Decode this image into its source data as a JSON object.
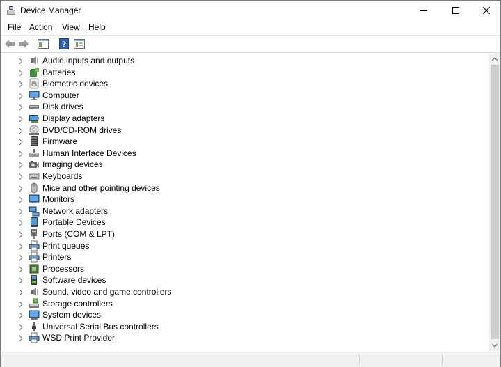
{
  "window": {
    "title": "Device Manager"
  },
  "menu": [
    {
      "label": "File",
      "key": "F",
      "rest": "ile"
    },
    {
      "label": "Action",
      "key": "A",
      "rest": "ction"
    },
    {
      "label": "View",
      "key": "V",
      "rest": "iew"
    },
    {
      "label": "Help",
      "key": "H",
      "rest": "elp"
    }
  ],
  "toolbar": {
    "buttons": [
      "back-arrow-icon",
      "forward-arrow-icon",
      "show-hide-console-tree-icon",
      "help-icon",
      "properties-icon"
    ]
  },
  "tree": {
    "items": [
      {
        "label": "Audio inputs and outputs",
        "icon": "speaker-icon"
      },
      {
        "label": "Batteries",
        "icon": "battery-icon"
      },
      {
        "label": "Biometric devices",
        "icon": "fingerprint-icon"
      },
      {
        "label": "Computer",
        "icon": "computer-icon"
      },
      {
        "label": "Disk drives",
        "icon": "disk-drive-icon"
      },
      {
        "label": "Display adapters",
        "icon": "display-adapter-icon"
      },
      {
        "label": "DVD/CD-ROM drives",
        "icon": "dvd-drive-icon"
      },
      {
        "label": "Firmware",
        "icon": "firmware-icon"
      },
      {
        "label": "Human Interface Devices",
        "icon": "hid-icon"
      },
      {
        "label": "Imaging devices",
        "icon": "camera-icon"
      },
      {
        "label": "Keyboards",
        "icon": "keyboard-icon"
      },
      {
        "label": "Mice and other pointing devices",
        "icon": "mouse-icon"
      },
      {
        "label": "Monitors",
        "icon": "monitor-icon"
      },
      {
        "label": "Network adapters",
        "icon": "network-adapter-icon"
      },
      {
        "label": "Portable Devices",
        "icon": "portable-device-icon"
      },
      {
        "label": "Ports (COM & LPT)",
        "icon": "port-icon"
      },
      {
        "label": "Print queues",
        "icon": "printer-icon"
      },
      {
        "label": "Printers",
        "icon": "printer-icon"
      },
      {
        "label": "Processors",
        "icon": "processor-icon"
      },
      {
        "label": "Software devices",
        "icon": "software-device-icon"
      },
      {
        "label": "Sound, video and game controllers",
        "icon": "speaker-icon"
      },
      {
        "label": "Storage controllers",
        "icon": "storage-controller-icon"
      },
      {
        "label": "System devices",
        "icon": "system-device-icon"
      },
      {
        "label": "Universal Serial Bus controllers",
        "icon": "usb-icon"
      },
      {
        "label": "WSD Print Provider",
        "icon": "printer-icon"
      }
    ]
  },
  "colors": {
    "accent_blue": "#2b7bd6",
    "status_bar": "#f0f0f0"
  }
}
